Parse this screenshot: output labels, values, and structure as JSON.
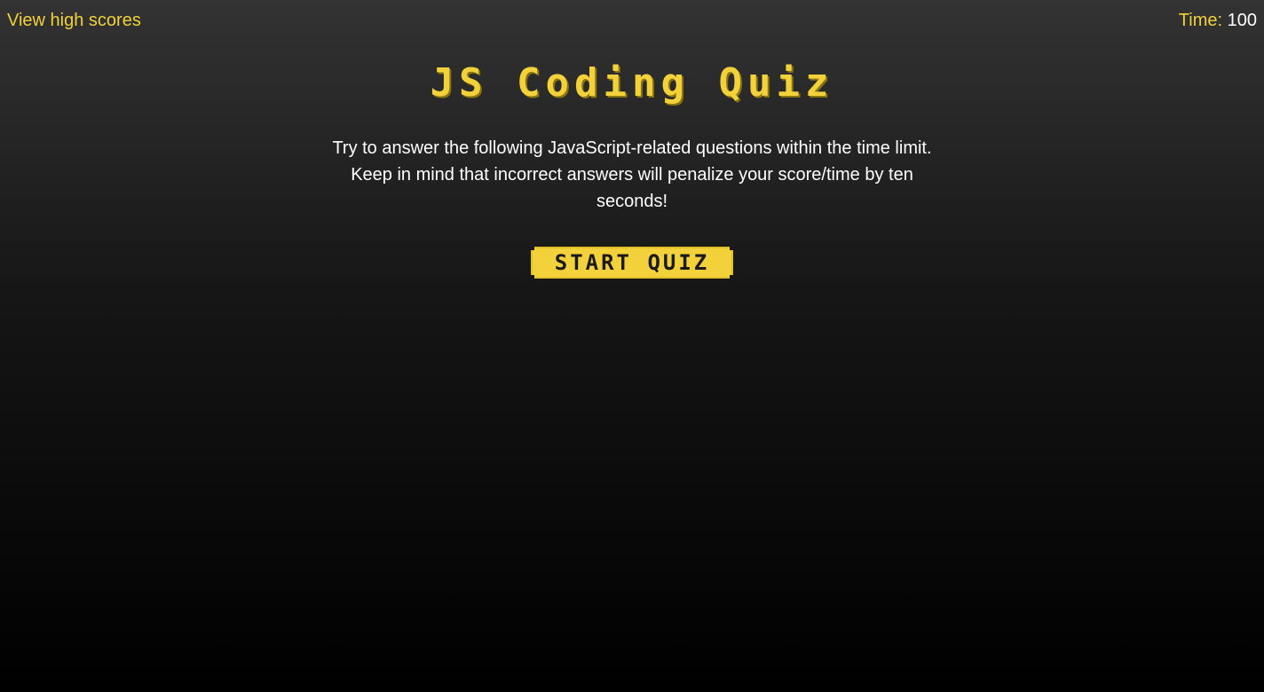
{
  "header": {
    "high_scores_link": "View high scores",
    "timer_label": "Time:",
    "timer_value": "100"
  },
  "main": {
    "title": "JS Coding Quiz",
    "intro_text": "Try to answer the following JavaScript-related questions within the time limit. Keep in mind that incorrect answers will penalize your score/time by ten seconds!",
    "start_button_label": "START QUIZ"
  },
  "colors": {
    "accent": "#f2d13a",
    "text": "#ffffff",
    "background_top": "#333333",
    "background_bottom": "#000000"
  }
}
